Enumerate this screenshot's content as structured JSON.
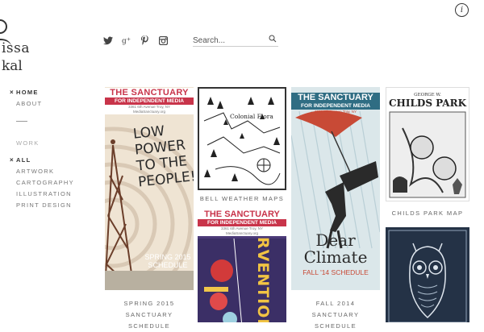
{
  "brand": {
    "line1": "issa",
    "line2": "kal"
  },
  "search": {
    "placeholder": "Search..."
  },
  "social": [
    "twitter-icon",
    "google-plus-icon",
    "pinterest-icon",
    "instagram-icon"
  ],
  "nav": {
    "pages": [
      {
        "label": "HOME",
        "active": true
      },
      {
        "label": "ABOUT",
        "active": false
      }
    ],
    "section_label": "WORK",
    "filters": [
      {
        "label": "ALL",
        "active": true
      },
      {
        "label": "ARTWORK",
        "active": false
      },
      {
        "label": "CARTOGRAPHY",
        "active": false
      },
      {
        "label": "ILLUSTRATION",
        "active": false
      },
      {
        "label": "PRINT DESIGN",
        "active": false
      }
    ]
  },
  "cards": [
    {
      "caption": "SPRING 2015 SANCTUARY SCHEDULE",
      "poster": {
        "header": "THE SANCTUARY",
        "subheader": "FOR INDEPENDENT MEDIA",
        "address": "3361 6th Avenue Troy, NY",
        "website": "MediaSanctuary.org",
        "words": [
          "LOW",
          "POWER",
          "TO THE",
          "PEOPLE!"
        ],
        "footer1": "SPRING 2015",
        "footer2": "SCHEDULE"
      }
    },
    {
      "caption": "BELL WEATHER MAPS",
      "poster": {
        "title": "Colonial Flora"
      }
    },
    {
      "caption": "",
      "poster": {
        "header": "THE SANCTUARY",
        "subheader": "FOR INDEPENDENT MEDIA",
        "address": "3361 6th Avenue Troy, NY",
        "website": "MediaSanctuary.org",
        "words": "RVENTIONS"
      }
    },
    {
      "caption": "FALL 2014 SANCTUARY SCHEDULE",
      "poster": {
        "header": "THE SANCTUARY",
        "subheader": "FOR INDEPENDENT MEDIA",
        "address": "3361 6th Avenue Troy, NY",
        "website": "MediaSanctuary.org",
        "title1": "Dear",
        "title2": "Climate",
        "footer": "FALL '14 SCHEDULE"
      }
    },
    {
      "caption": "CHILDS PARK MAP",
      "poster": {
        "top": "GEORGE W.",
        "title": "CHILDS PARK"
      }
    },
    {
      "caption": "",
      "poster": {}
    }
  ],
  "colors": {
    "sanctuary_red": "#c8344a",
    "cream": "#f1e6d6",
    "ink": "#222222",
    "dark_blue": "#243246"
  }
}
